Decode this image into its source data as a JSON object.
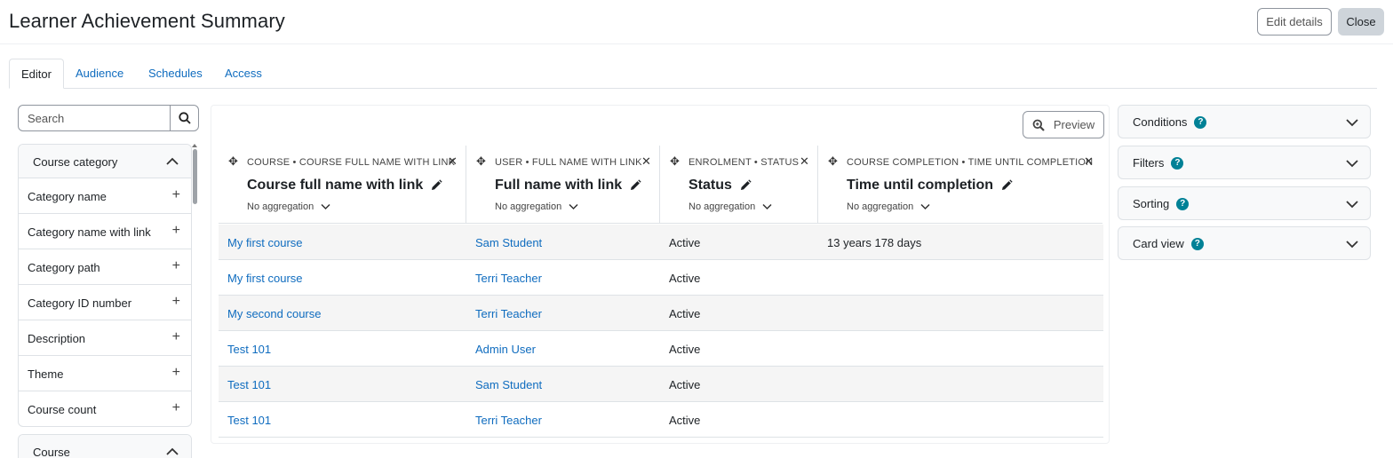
{
  "page": {
    "title": "Learner Achievement Summary"
  },
  "header": {
    "edit_label": "Edit details",
    "close_label": "Close"
  },
  "tabs": [
    {
      "label": "Editor",
      "active": true
    },
    {
      "label": "Audience",
      "active": false
    },
    {
      "label": "Schedules",
      "active": false
    },
    {
      "label": "Access",
      "active": false
    }
  ],
  "sidebar": {
    "search_placeholder": "Search",
    "groups": [
      {
        "title": "Course category",
        "items": [
          "Category name",
          "Category name with link",
          "Category path",
          "Category ID number",
          "Description",
          "Theme",
          "Course count"
        ]
      },
      {
        "title": "Course",
        "items": []
      }
    ]
  },
  "main": {
    "preview_label": "Preview",
    "columns": [
      {
        "meta": "COURSE • COURSE FULL NAME WITH LINK",
        "title": "Course full name with link",
        "aggregation": "No aggregation"
      },
      {
        "meta": "USER • FULL NAME WITH LINK",
        "title": "Full name with link",
        "aggregation": "No aggregation"
      },
      {
        "meta": "ENROLMENT • STATUS",
        "title": "Status",
        "aggregation": "No aggregation"
      },
      {
        "meta": "COURSE COMPLETION • TIME UNTIL COMPLETION",
        "title": "Time until completion",
        "aggregation": "No aggregation"
      }
    ],
    "rows": [
      [
        "My first course",
        "Sam Student",
        "Active",
        "13 years 178 days"
      ],
      [
        "My first course",
        "Terri Teacher",
        "Active",
        ""
      ],
      [
        "My second course",
        "Terri Teacher",
        "Active",
        ""
      ],
      [
        "Test 101",
        "Admin User",
        "Active",
        ""
      ],
      [
        "Test 101",
        "Sam Student",
        "Active",
        ""
      ],
      [
        "Test 101",
        "Terri Teacher",
        "Active",
        ""
      ]
    ]
  },
  "right_panels": [
    {
      "title": "Conditions"
    },
    {
      "title": "Filters"
    },
    {
      "title": "Sorting"
    },
    {
      "title": "Card view"
    }
  ],
  "icons": {
    "search": "search-icon",
    "preview": "magnifier-icon",
    "move": "move-icon",
    "remove": "close-icon",
    "edit": "pencil-icon",
    "chevron": "chevron-down-icon",
    "collapse": "chevron-up-icon",
    "add": "plus-icon",
    "help": "help-icon"
  },
  "colors": {
    "link": "#0f6cbf",
    "help": "#008196",
    "close_button": "#ced4da"
  }
}
